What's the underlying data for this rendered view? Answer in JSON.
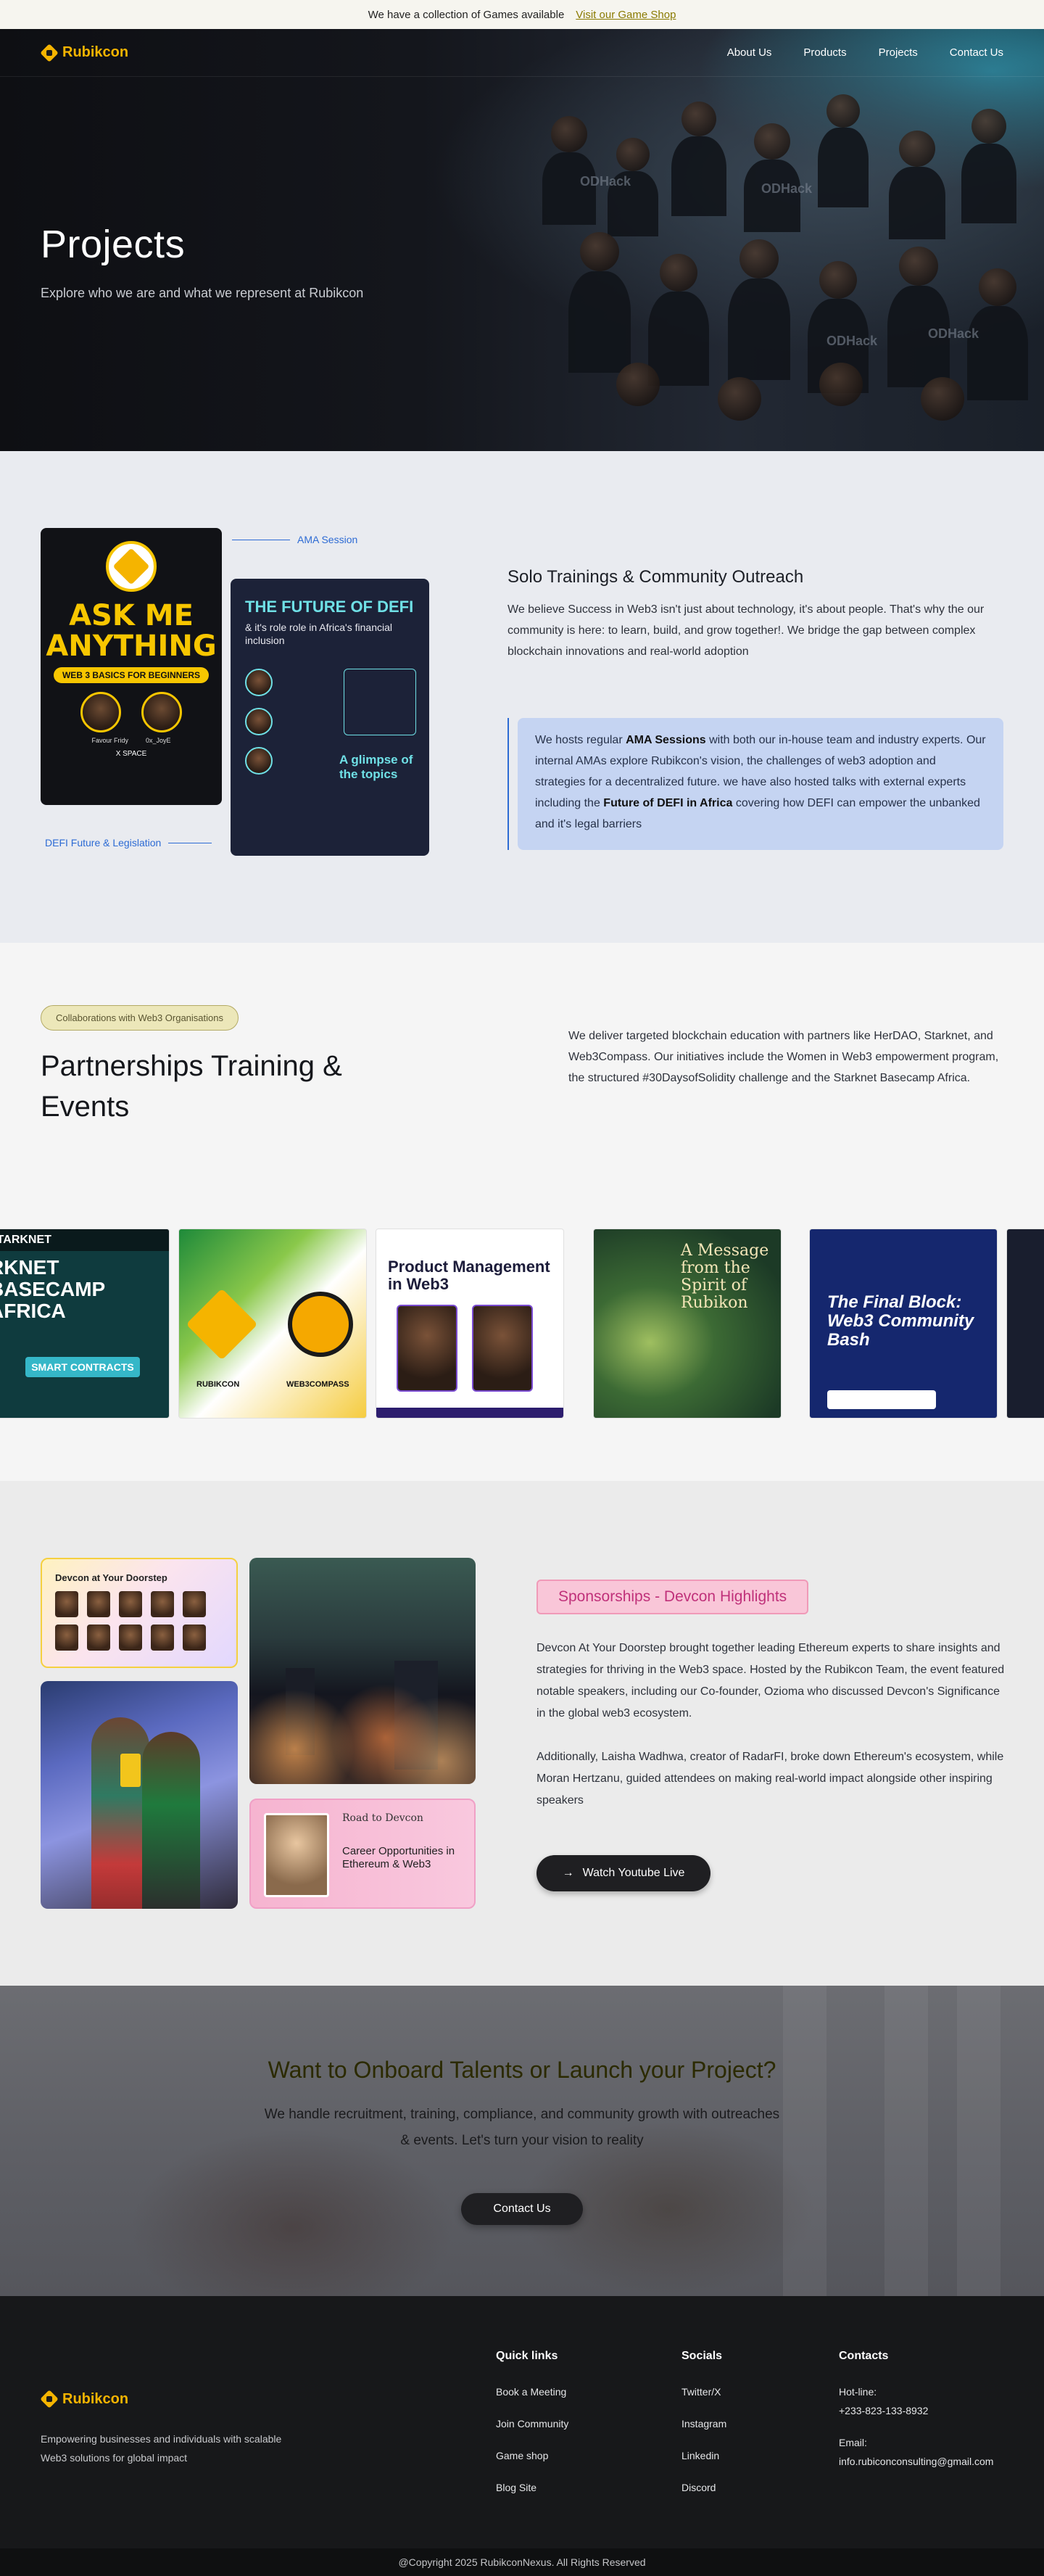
{
  "announcement": {
    "text": "We have a collection of Games available",
    "link": "Visit our Game Shop"
  },
  "brand": {
    "name": "Rubikcon",
    "accent": "#f5b400"
  },
  "nav": {
    "items": [
      "About Us",
      "Products",
      "Projects",
      "Contact Us"
    ]
  },
  "hero": {
    "title": "Projects",
    "subtitle": "Explore who we are and what we represent at Rubikcon"
  },
  "solo": {
    "callout_ama": "AMA Session",
    "callout_defi": "DEFI Future & Legislation",
    "poster_ama": {
      "title": "ASK ME ANYTHING",
      "pill": "WEB 3 BASICS FOR BEGINNERS",
      "host1": "Favour Fridy",
      "host2": "0x_JoyE",
      "meta": "X SPACE"
    },
    "poster_defi": {
      "title": "THE FUTURE OF DEFI",
      "subtitle": "& it's role role in Africa's financial inclusion",
      "glimpse": "A glimpse of the topics"
    },
    "heading": "Solo Trainings & Community Outreach",
    "lead": "We believe Success in Web3 isn't just about technology, it's about people. That's why the our community is here: to learn, build, and grow together!. We bridge the gap between complex blockchain innovations and real-world adoption",
    "quote_pre": "We hosts regular ",
    "quote_bold1": "AMA Sessions",
    "quote_mid": " with both our in-house team and industry experts. Our internal AMAs explore Rubikcon's vision, the challenges of web3 adoption and strategies for a decentralized future. we have also hosted talks with external experts including the ",
    "quote_bold2": "Future of DEFI in Africa",
    "quote_post": " covering how DEFI can empower the unbanked and it's legal barriers"
  },
  "partners": {
    "chip": "Collaborations with Web3 Organisations",
    "heading": "Partnerships Training & Events",
    "description": "We deliver targeted blockchain education with partners like HerDAO, Starknet, and Web3Compass. Our initiatives include the Women in Web3 empowerment program, the structured #30DaysofSolidity challenge and the Starknet Basecamp Africa.",
    "cards": {
      "starknet_header": "STARKNET",
      "starknet_title": "RKNET BASECAMP AFRICA",
      "starknet_button": "SMART CONTRACTS",
      "rubikcon_label": "RUBIKCON",
      "compass_label": "WEB3COMPASS",
      "pm_title": "Product Management in Web3",
      "spirit_title": "A Message from the Spirit of Rubikon",
      "bash_title": "The Final Block: Web3 Community Bash"
    }
  },
  "devcon": {
    "photo1_title": "Devcon at Your Doorstep",
    "photo4_road": "Road to Devcon",
    "photo4_title": "Career Opportunities in Ethereum & Web3",
    "chip": "Sponsorships - Devcon Highlights",
    "para1": "Devcon At Your Doorstep brought together leading Ethereum experts to share insights and strategies for thriving in the Web3 space. Hosted by the Rubikcon Team, the event featured notable speakers, including our Co-founder, Ozioma who discussed Devcon's Significance in the global web3 ecosystem.",
    "para2": "Additionally, Laisha Wadhwa, creator of RadarFI, broke down Ethereum's ecosystem, while Moran Hertzanu, guided attendees on making real-world impact alongside other inspiring speakers",
    "youtube_label": "Watch Youtube Live"
  },
  "cta": {
    "heading": "Want to Onboard Talents or Launch your Project?",
    "text": "We handle recruitment, training, compliance, and community growth with outreaches & events. Let's turn your vision to reality",
    "button": "Contact Us"
  },
  "footer": {
    "tagline": "Empowering businesses and individuals with scalable Web3 solutions for global impact",
    "quick_links": {
      "title": "Quick links",
      "items": [
        "Book a Meeting",
        "Join Community",
        "Game shop",
        "Blog Site"
      ]
    },
    "socials": {
      "title": "Socials",
      "items": [
        "Twitter/X",
        "Instagram",
        "Linkedin",
        "Discord"
      ]
    },
    "contacts": {
      "title": "Contacts",
      "hotline_label": "Hot-line:",
      "hotline": "+233-823-133-8932",
      "email_label": "Email:",
      "email": "info.rubiconconsulting@gmail.com"
    },
    "copyright": "@Copyright 2025 RubikconNexus. All Rights Reserved"
  }
}
